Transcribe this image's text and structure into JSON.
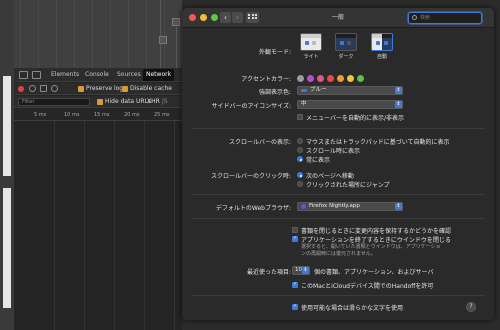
{
  "devtools": {
    "tabs": [
      "Elements",
      "Console",
      "Sources",
      "Network"
    ],
    "active_tab": "Network",
    "preserve_log": "Preserve log",
    "disable_cache": "Disable cache",
    "filter_placeholder": "Filter",
    "hide_data_urls": "Hide data URLs",
    "xhr": "XHR",
    "timeline_ticks": [
      "5 ms",
      "10 ms",
      "15 ms",
      "20 ms",
      "25 ms"
    ]
  },
  "window": {
    "title": "一般",
    "search_placeholder": "検索"
  },
  "prefs": {
    "appearance_label": "外観モード:",
    "appearance_options": [
      "ライト",
      "ダーク",
      "自動"
    ],
    "accent_label": "アクセントカラー:",
    "accent_colors": [
      "#9b9b9b",
      "#b74fcf",
      "#e0558f",
      "#e84a4a",
      "#f09a38",
      "#e8c93a",
      "#5fbf4a"
    ],
    "highlight_label": "強調表示色:",
    "highlight_value": "ブルー",
    "sidebar_icon_label": "サイドバーのアイコンサイズ:",
    "sidebar_icon_value": "中",
    "menubar_auto": "メニューバーを自動的に表示/非表示",
    "scrollbar_label": "スクロールバーの表示:",
    "scrollbar_options": [
      "マウスまたはトラックパッドに基づいて自動的に表示",
      "スクロール時に表示",
      "常に表示"
    ],
    "scrollclick_label": "スクロールバーのクリック時:",
    "scrollclick_options": [
      "次のページへ移動",
      "クリックされた場所にジャンプ"
    ],
    "browser_label": "デフォルトのWebブラウザ:",
    "browser_value": "Firefox Nightly.app",
    "ask_keep_changes": "書類を閉じるときに変更内容を保持するかどうかを確認",
    "close_windows": "アプリケーションを終了するときにウインドウを閉じる",
    "close_windows_note": "選択すると、開いていた書類とウインドウは、アプリケーションの再開時には復元されません。",
    "recent_label": "最近使った項目:",
    "recent_value": "10",
    "recent_suffix": "個の書類、アプリケーション、およびサーバ",
    "handoff": "このMacとiCloudデバイス間でのHandoffを許可",
    "font_smoothing": "使用可能な場合は滑らかな文字を使用",
    "help": "?"
  }
}
